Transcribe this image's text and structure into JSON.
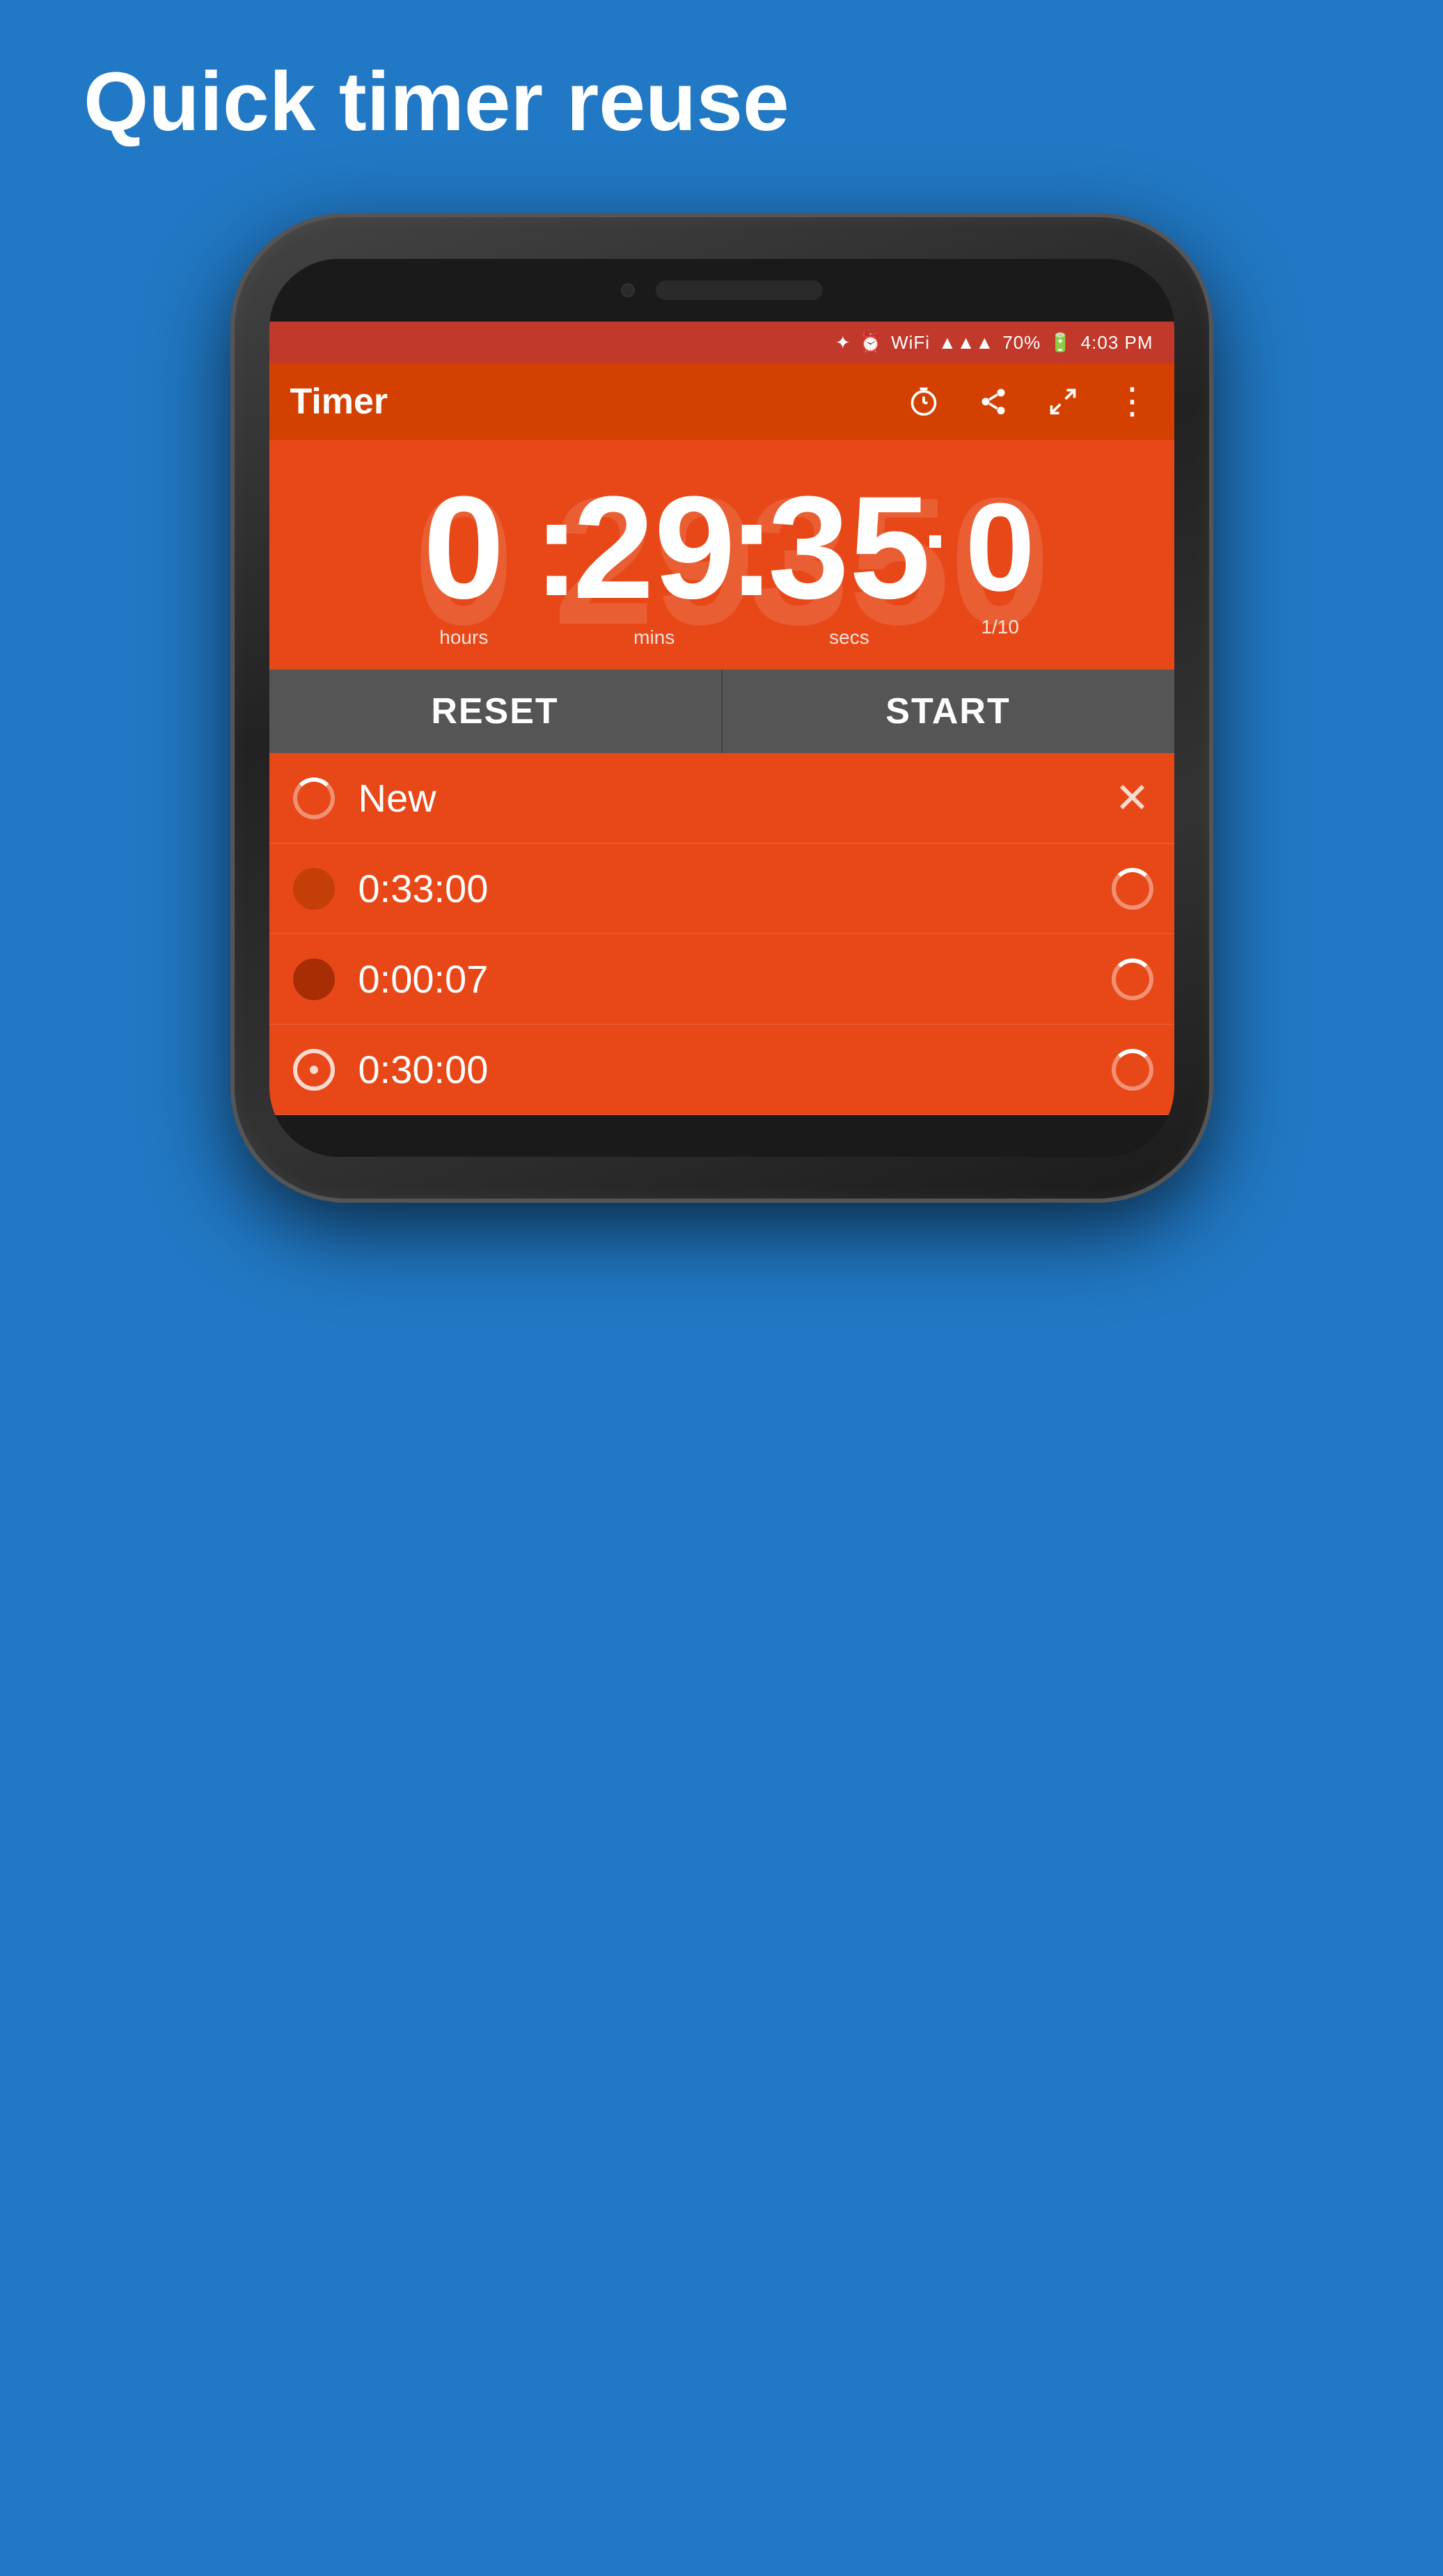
{
  "page": {
    "title": "Quick timer reuse",
    "background_color": "#2178C4"
  },
  "status_bar": {
    "battery_percent": "70%",
    "time": "4:03 PM",
    "icons": [
      "bluetooth",
      "alarm",
      "wifi",
      "signal"
    ]
  },
  "app_bar": {
    "title": "Timer",
    "icon_timer": "⧗",
    "icon_share": "share",
    "icon_expand": "expand",
    "icon_more": "⋮"
  },
  "timer": {
    "hours": "0",
    "minutes": "29",
    "seconds": "35",
    "tenths": "0",
    "hours_label": "hours",
    "minutes_label": "mins",
    "seconds_label": "secs",
    "tenths_label": "1/10"
  },
  "buttons": {
    "reset": "RESET",
    "start": "START"
  },
  "timer_list": [
    {
      "id": 1,
      "label": "New",
      "icon_type": "spinner",
      "action": "×"
    },
    {
      "id": 2,
      "label": "0:33:00",
      "icon_type": "circle-full",
      "action": "reload"
    },
    {
      "id": 3,
      "label": "0:00:07",
      "icon_type": "circle-partial",
      "action": "reload"
    },
    {
      "id": 4,
      "label": "0:30:00",
      "icon_type": "circle-outline",
      "action": "reload"
    }
  ]
}
